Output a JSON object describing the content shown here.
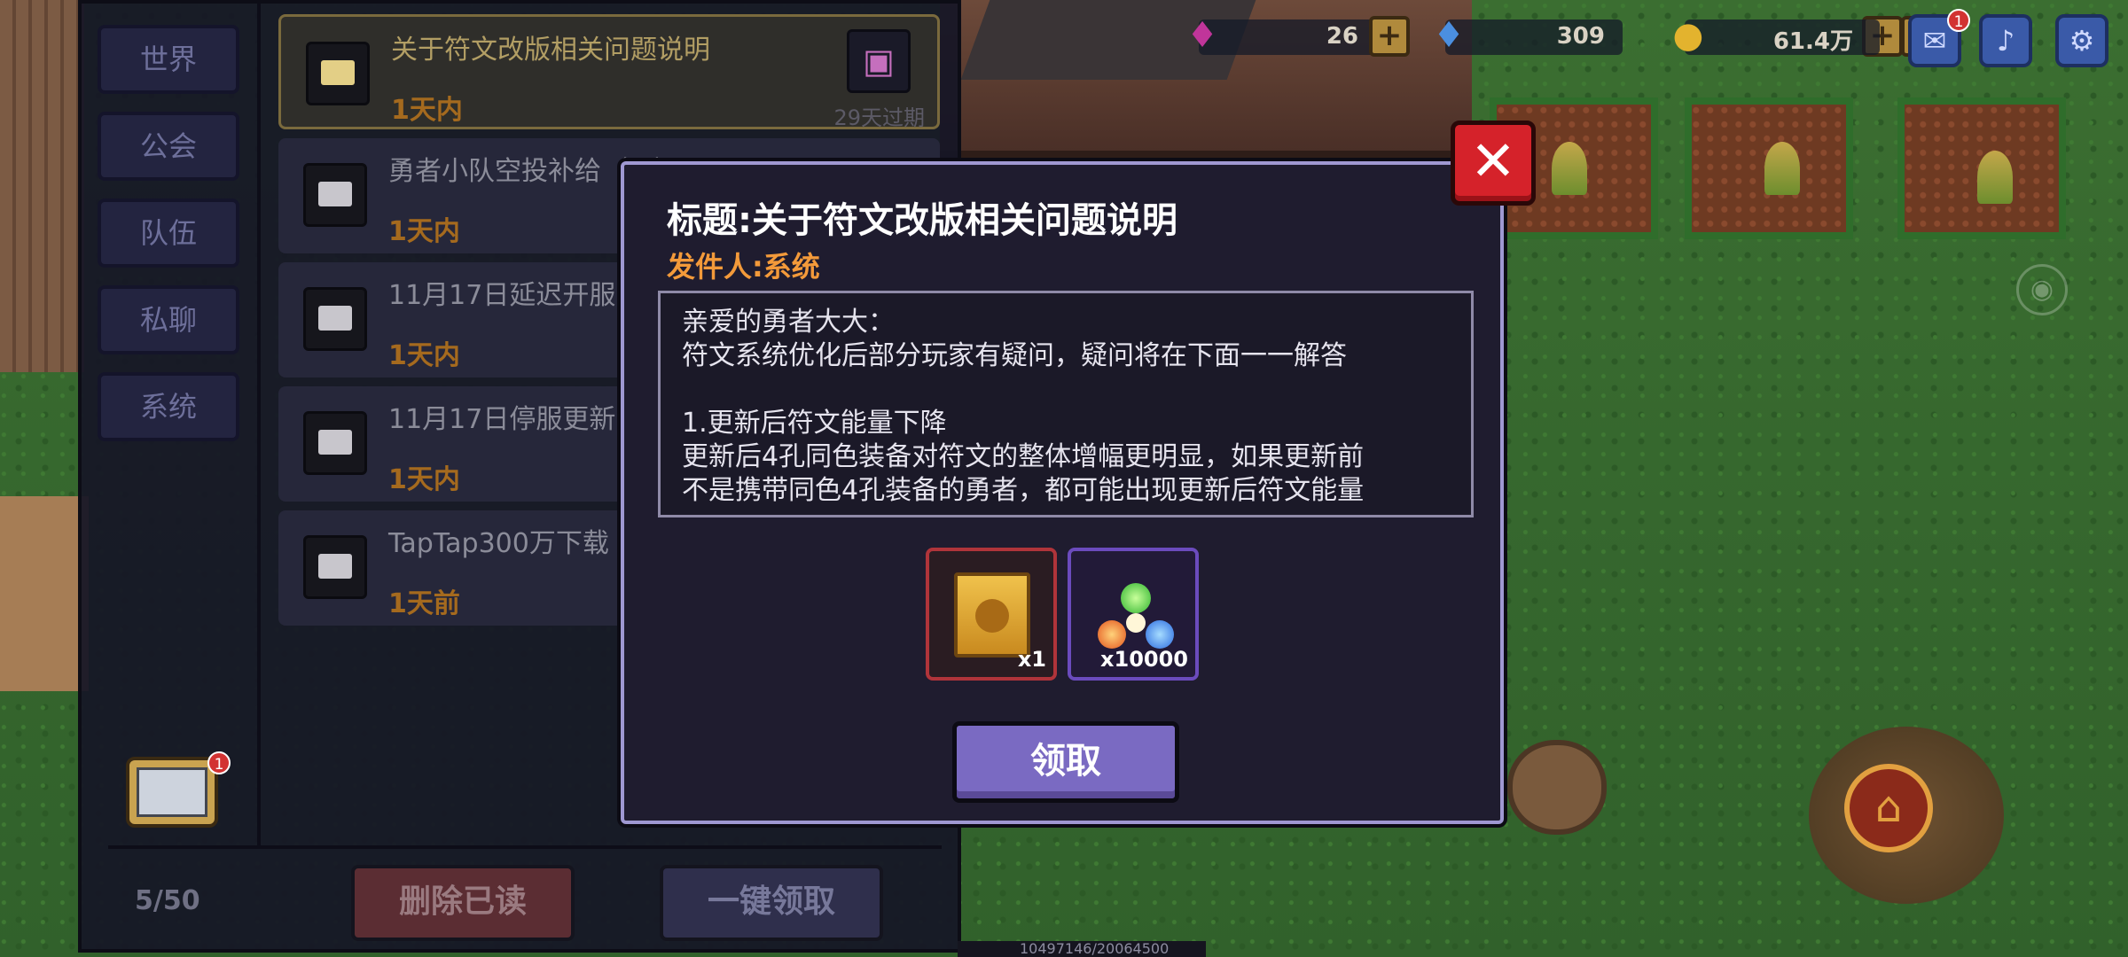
{
  "topbar": {
    "gems_purple": "26",
    "gems_blue": "309",
    "gold": "61.4万",
    "plus": "+",
    "mail_badge": "1"
  },
  "tabs": [
    {
      "label": "世界"
    },
    {
      "label": "公会"
    },
    {
      "label": "队伍"
    },
    {
      "label": "私聊"
    },
    {
      "label": "系统"
    }
  ],
  "mails": [
    {
      "title": "关于符文改版相关问题说明",
      "time": "1天内",
      "expire": "29天过期"
    },
    {
      "title": "勇者小队空投补给（一）",
      "time": "1天内"
    },
    {
      "title": "11月17日延迟开服",
      "time": "1天内"
    },
    {
      "title": "11月17日停服更新",
      "time": "1天内"
    },
    {
      "title": "TapTap300万下载",
      "time": "1天前"
    }
  ],
  "mail_panel": {
    "count": "5/50",
    "delete_read": "删除已读",
    "claim_all": "一键领取",
    "badge": "1"
  },
  "dialog": {
    "title": "标题:关于符文改版相关问题说明",
    "sender": "发件人:系统",
    "body": [
      "亲爱的勇者大大：",
      "符文系统优化后部分玩家有疑问，疑问将在下面一一解答",
      "",
      "1.更新后符文能量下降",
      "更新后4孔同色装备对符文的整体增幅更明显，如果更新前",
      "不是携带同色4孔装备的勇者，都可能出现更新后符文能量"
    ],
    "rewards": [
      {
        "name": "golden-chest",
        "qty": "x1"
      },
      {
        "name": "rune-gems",
        "qty": "x10000"
      }
    ],
    "claim": "领取",
    "close": "✕"
  },
  "xp_text": "10497146/20064500",
  "colors": {
    "dialog_border": "#9f98d2",
    "sender": "#f39a3a",
    "close": "#d5222a",
    "claim": "#7a6ac2"
  }
}
